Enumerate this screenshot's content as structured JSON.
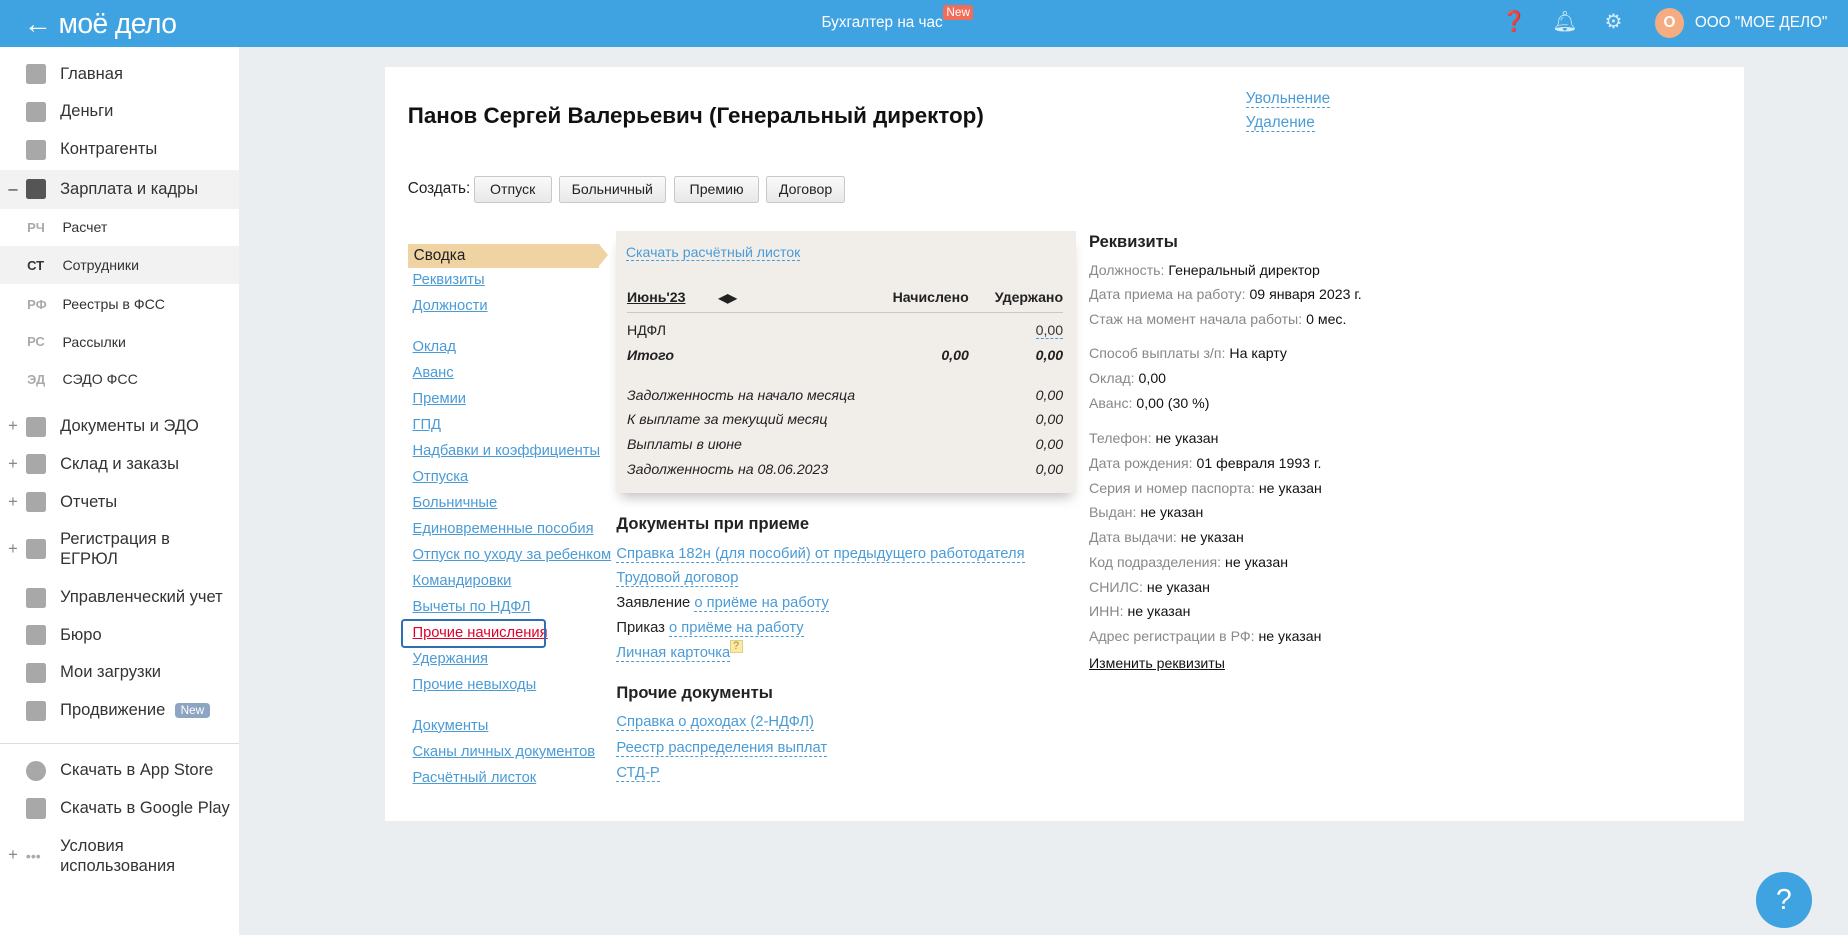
{
  "header": {
    "logo": "моё дело",
    "center_link": "Бухгалтер на час",
    "center_badge": "New",
    "avatar_letter": "О",
    "org_name": "ООО \"МОЕ ДЕЛО\""
  },
  "sidebar": {
    "items_top": [
      {
        "label": "Главная",
        "icon": "home-icon"
      },
      {
        "label": "Деньги",
        "icon": "money-icon"
      },
      {
        "label": "Контрагенты",
        "icon": "contractor-icon"
      },
      {
        "label": "Зарплата и кадры",
        "icon": "wallet-icon",
        "expanded": true
      }
    ],
    "sub": [
      {
        "abbr": "РЧ",
        "label": "Расчет"
      },
      {
        "abbr": "СТ",
        "label": "Сотрудники",
        "active": true
      },
      {
        "abbr": "РФ",
        "label": "Реестры в ФСС"
      },
      {
        "abbr": "РС",
        "label": "Рассылки"
      },
      {
        "abbr": "ЭД",
        "label": "СЭДО ФСС"
      }
    ],
    "items_bottom": [
      {
        "label": "Документы и ЭДО"
      },
      {
        "label": "Склад и заказы"
      },
      {
        "label": "Отчеты"
      },
      {
        "label": "Регистрация в ЕГРЮЛ"
      },
      {
        "label": "Управленческий учет"
      },
      {
        "label": "Бюро"
      },
      {
        "label": "Мои загрузки"
      },
      {
        "label": "Продвижение",
        "badge": "New"
      }
    ],
    "extra": [
      {
        "label": "Скачать в App Store"
      },
      {
        "label": "Скачать в Google Play"
      },
      {
        "label": "Условия использования"
      }
    ]
  },
  "employee": {
    "title": "Панов Сергей Валерьевич (Генеральный директор)",
    "actions": [
      "Увольнение",
      "Удаление"
    ]
  },
  "create": {
    "label": "Создать:",
    "buttons": [
      "Отпуск",
      "Больничный",
      "Премию",
      "Договор"
    ]
  },
  "nav": {
    "active": "Сводка",
    "group1": [
      "Реквизиты",
      "Должности"
    ],
    "group2": [
      "Оклад",
      "Аванс",
      "Премии",
      "ГПД",
      "Надбавки и коэффициенты",
      "Отпуска",
      "Больничные",
      "Единовременные пособия",
      "Отпуск по уходу за ребенком",
      "Командировки",
      "Вычеты по НДФЛ",
      "Прочие начисления",
      "Удержания",
      "Прочие невыходы"
    ],
    "group3": [
      "Документы",
      "Сканы личных документов",
      "Расчётный листок"
    ]
  },
  "payslip": {
    "download": "Скачать расчётный листок",
    "month": "Июнь'23",
    "col_accrued": "Начислено",
    "col_withheld": "Удержано",
    "ndfl_label": "НДФЛ",
    "ndfl_value": "0,00",
    "total_label": "Итого",
    "total_accrued": "0,00",
    "total_withheld": "0,00",
    "rows": [
      {
        "label": "Задолженность на начало месяца",
        "value": "0,00"
      },
      {
        "label": "К выплате за текущий месяц",
        "value": "0,00"
      },
      {
        "label": "Выплаты в июне",
        "value": "0,00"
      },
      {
        "label": "Задолженность на 08.06.2023",
        "value": "0,00"
      }
    ]
  },
  "hire_docs": {
    "title": "Документы при приеме",
    "link1": "Справка 182н (для пособий) от предыдущего работодателя",
    "link2": "Трудовой договор",
    "app_prefix": "Заявление",
    "app_link": "о приёме на работу",
    "order_prefix": "Приказ",
    "order_link": "о приёме на работу",
    "card_link": "Личная карточка",
    "help": "?"
  },
  "other_docs": {
    "title": "Прочие документы",
    "links": [
      "Справка о доходах (2-НДФЛ)",
      "Реестр распределения выплат",
      "СТД-Р"
    ]
  },
  "requisites": {
    "title": "Реквизиты",
    "rows": [
      {
        "k": "Должность:",
        "v": "Генеральный директор"
      },
      {
        "k": "Дата приема на работу:",
        "v": "09 января 2023 г."
      },
      {
        "k": "Стаж на момент начала работы:",
        "v": "0 мес."
      },
      {
        "k": "Способ выплаты з/п:",
        "v": "На карту"
      },
      {
        "k": "Оклад:",
        "v": "0,00"
      },
      {
        "k": "Аванс:",
        "v": "0,00 (30 %)"
      },
      {
        "k": "Телефон:",
        "v": "не указан"
      },
      {
        "k": "Дата рождения:",
        "v": "01 февраля 1993 г."
      },
      {
        "k": "Серия и номер паспорта:",
        "v": "не указан"
      },
      {
        "k": "Выдан:",
        "v": "не указан"
      },
      {
        "k": "Дата выдачи:",
        "v": "не указан"
      },
      {
        "k": "Код подразделения:",
        "v": "не указан"
      },
      {
        "k": "СНИЛС:",
        "v": "не указан"
      },
      {
        "k": "ИНН:",
        "v": "не указан"
      },
      {
        "k": "Адрес регистрации в РФ:",
        "v": "не указан"
      }
    ],
    "edit_link": "Изменить реквизиты"
  },
  "help_button": "?"
}
